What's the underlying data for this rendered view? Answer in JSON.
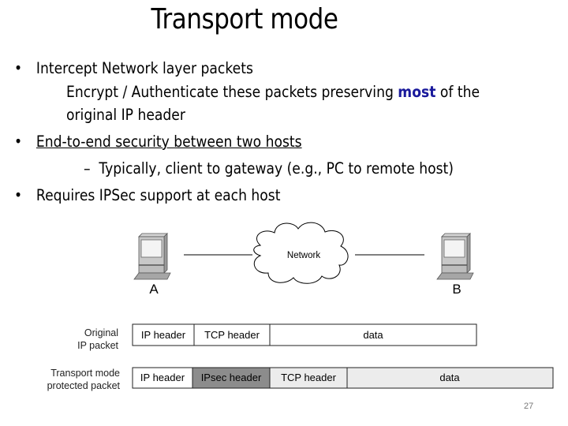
{
  "slide": {
    "title": "Transport mode",
    "page_number": "27",
    "accent_color": "#1a1a9c"
  },
  "bullets": {
    "b1_line1": "Intercept Network layer packets",
    "b1_line2_pre": "Encrypt / Authenticate these packets preserving ",
    "b1_line2_emph": "most",
    "b1_line2_post": " of the",
    "b1_line3": "original IP header",
    "b2": "End-to-end security between two hosts",
    "b2_sub": "Typically, client to gateway (e.g., PC to remote host)",
    "b3": "Requires IPSec support at each host",
    "bullet_glyph": "•",
    "dash_glyph": "–"
  },
  "diagram": {
    "host_a": "A",
    "host_b": "B",
    "network": "Network",
    "original_label_1": "Original",
    "original_label_2": "IP packet",
    "protected_label_1": "Transport mode",
    "protected_label_2": "protected packet",
    "original_fields": [
      "IP header",
      "TCP header",
      "data"
    ],
    "protected_fields": [
      "IP header",
      "IPsec header",
      "TCP header",
      "data"
    ]
  }
}
